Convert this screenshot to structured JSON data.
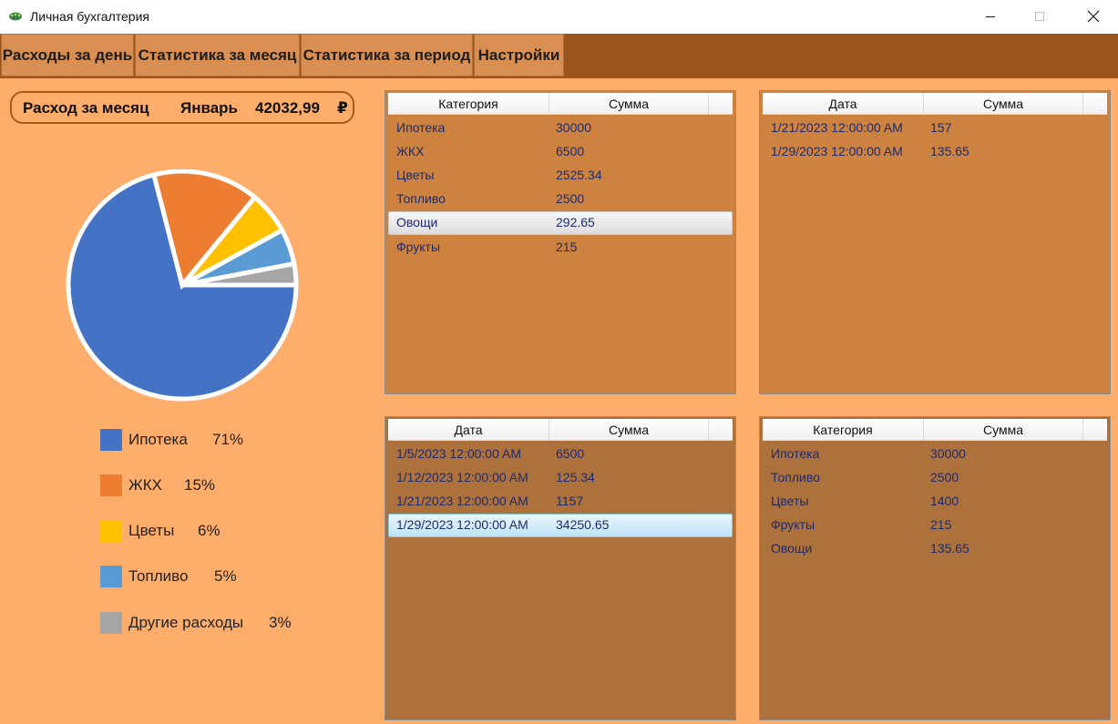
{
  "window": {
    "title": "Личная бухгалтерия"
  },
  "menu": {
    "items": [
      {
        "label": "Расходы за день"
      },
      {
        "label": "Статистика за месяц"
      },
      {
        "label": "Статистика за период"
      },
      {
        "label": "Настройки"
      }
    ]
  },
  "summary": {
    "label": "Расход за месяц",
    "month": "Январь",
    "amount": "42032,99",
    "currency": "₽"
  },
  "chart_data": {
    "type": "pie",
    "categories": [
      "Ипотека",
      "ЖКХ",
      "Цветы",
      "Топливо",
      "Другие расходы"
    ],
    "values": [
      71,
      15,
      6,
      5,
      3
    ],
    "colors": [
      "#4472c4",
      "#ed7d31",
      "#ffc000",
      "#5b9bd5",
      "#a5a5a5"
    ],
    "legend": [
      {
        "label": "Ипотека",
        "percent": "71%",
        "color": "#4472c4"
      },
      {
        "label": "ЖКХ",
        "percent": "15%",
        "color": "#ed7d31"
      },
      {
        "label": "Цветы",
        "percent": "6%",
        "color": "#ffc000"
      },
      {
        "label": "Топливо",
        "percent": "5%",
        "color": "#5b9bd5"
      },
      {
        "label": "Другие расходы",
        "percent": "3%",
        "color": "#a5a5a5"
      }
    ]
  },
  "grids": {
    "top_left": {
      "headers": [
        "Категория",
        "Сумма"
      ],
      "rows": [
        [
          "Ипотека",
          "30000"
        ],
        [
          "ЖКХ",
          "6500"
        ],
        [
          "Цветы",
          "2525.34"
        ],
        [
          "Топливо",
          "2500"
        ],
        [
          "Овощи",
          "292.65"
        ],
        [
          "Фрукты",
          "215"
        ]
      ],
      "selected_index": 4
    },
    "top_right": {
      "headers": [
        "Дата",
        "Сумма"
      ],
      "rows": [
        [
          "1/21/2023 12:00:00 AM",
          "157"
        ],
        [
          "1/29/2023 12:00:00 AM",
          "135.65"
        ]
      ]
    },
    "bottom_left": {
      "headers": [
        "Дата",
        "Сумма"
      ],
      "rows": [
        [
          "1/5/2023 12:00:00 AM",
          "6500"
        ],
        [
          "1/12/2023 12:00:00 AM",
          "125.34"
        ],
        [
          "1/21/2023 12:00:00 AM",
          "1157"
        ],
        [
          "1/29/2023 12:00:00 AM",
          "34250.65"
        ]
      ],
      "selected_index": 3
    },
    "bottom_right": {
      "headers": [
        "Категория",
        "Сумма"
      ],
      "rows": [
        [
          "Ипотека",
          "30000"
        ],
        [
          "Топливо",
          "2500"
        ],
        [
          "Цветы",
          "1400"
        ],
        [
          "Фрукты",
          "215"
        ],
        [
          "Овощи",
          "135.65"
        ]
      ]
    }
  },
  "colors": {
    "menu_bar": "#9a541c",
    "menu_item": "#d98e52",
    "background": "#ffad6a",
    "grid_top": "#cd8240",
    "grid_bottom": "#ad713c",
    "grid_text": "#1f2a6b"
  }
}
